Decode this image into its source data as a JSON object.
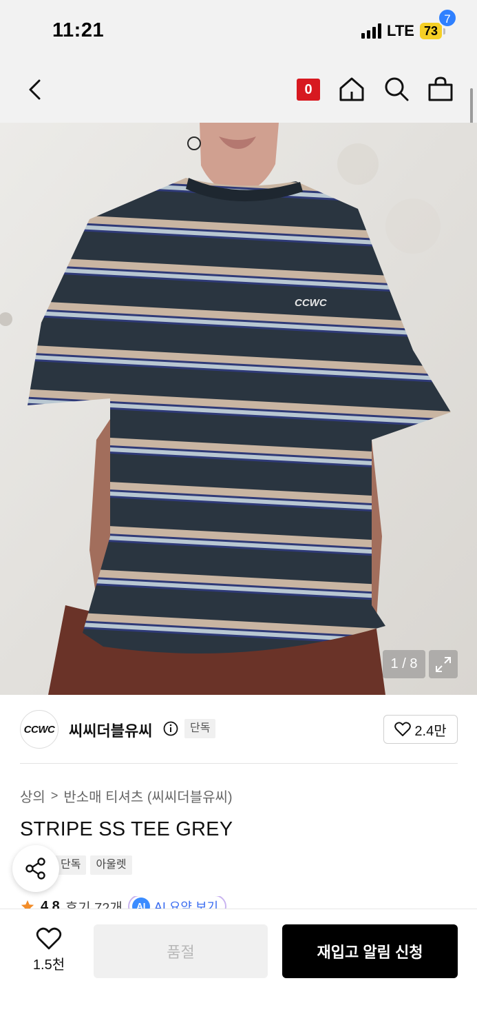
{
  "status_bar": {
    "time": "11:21",
    "network": "LTE",
    "battery": "73"
  },
  "nav": {
    "badge_count": "0",
    "cart_count": "7",
    "icons": [
      "back-icon",
      "home-icon",
      "search-icon",
      "cart-icon"
    ]
  },
  "hero": {
    "pager": "1 / 8",
    "shirt_logo": "CCWC"
  },
  "brand": {
    "logo_text": "CCWC",
    "name": "씨씨더블유씨",
    "tag": "단독",
    "likes": "2.4만"
  },
  "product": {
    "breadcrumb": [
      "상의",
      "반소매 티셔츠 (씨씨더블유씨)"
    ],
    "title": "STRIPE SS TEE GREY",
    "tags": [
      "단독",
      "아울렛"
    ],
    "rating": "4.8",
    "reviews": "후기 72개",
    "ai_badge": "AI",
    "ai_summary": "AI 요약 보기"
  },
  "bottom_bar": {
    "wish_count": "1.5천",
    "soldout_label": "품절",
    "restock_label": "재입고 알림 신청"
  },
  "colors": {
    "accent_red": "#d71920",
    "cart_badge_blue": "#2f80ff",
    "battery_yellow": "#f5cf25",
    "primary_button": "#000000",
    "star": "#f28c28"
  }
}
